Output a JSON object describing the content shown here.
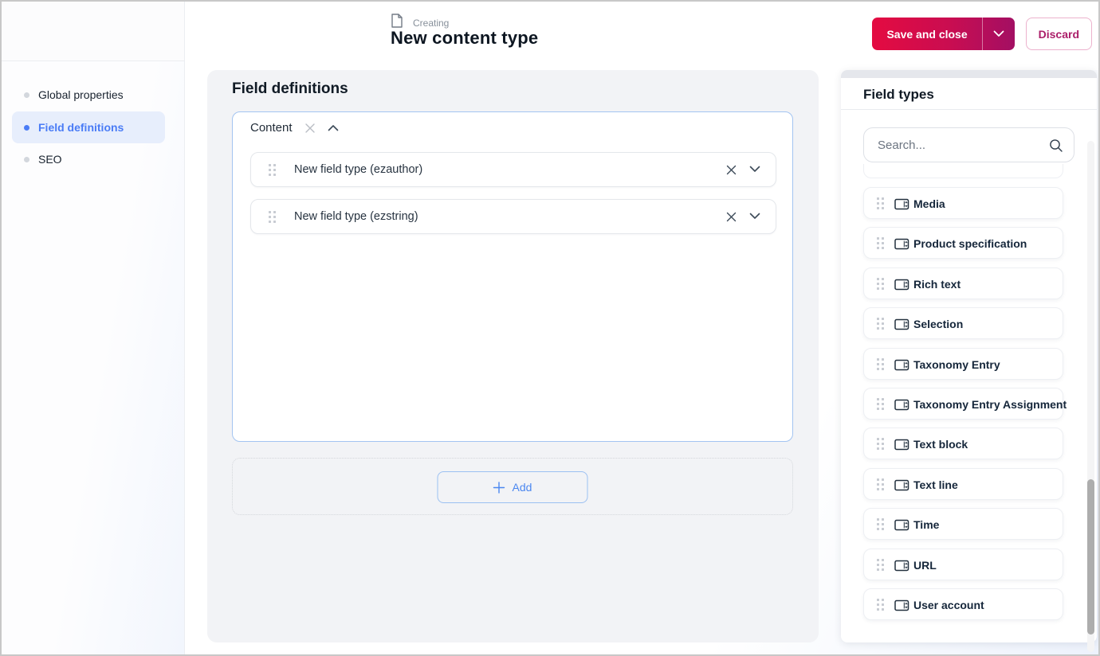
{
  "header": {
    "context_label": "Creating",
    "title": "New content type",
    "save_button": "Save and close",
    "discard_button": "Discard"
  },
  "sidebar": {
    "items": [
      {
        "label": "Global properties",
        "active": false
      },
      {
        "label": "Field definitions",
        "active": true
      },
      {
        "label": "SEO",
        "active": false
      }
    ]
  },
  "main": {
    "section_title": "Field definitions",
    "group": {
      "label": "Content",
      "fields": [
        {
          "label": "New field type (ezauthor)"
        },
        {
          "label": "New field type (ezstring)"
        }
      ]
    },
    "add_button": "Add"
  },
  "field_types_panel": {
    "title": "Field types",
    "search_placeholder": "Search...",
    "items": [
      "Media",
      "Product specification",
      "Rich text",
      "Selection",
      "Taxonomy Entry",
      "Taxonomy Entry Assignment",
      "Text block",
      "Text line",
      "Time",
      "URL",
      "User account"
    ]
  },
  "colors": {
    "accent_gradient_start": "#e40b41",
    "accent_gradient_end": "#a30f63",
    "discard_text": "#ab1e69",
    "active_link_blue": "#4a7cf6",
    "active_link_bg": "#e7eefc",
    "panel_bg": "#f2f3f6",
    "group_border_blue": "#a3c4f1",
    "add_button_blue": "#4b87f0"
  }
}
